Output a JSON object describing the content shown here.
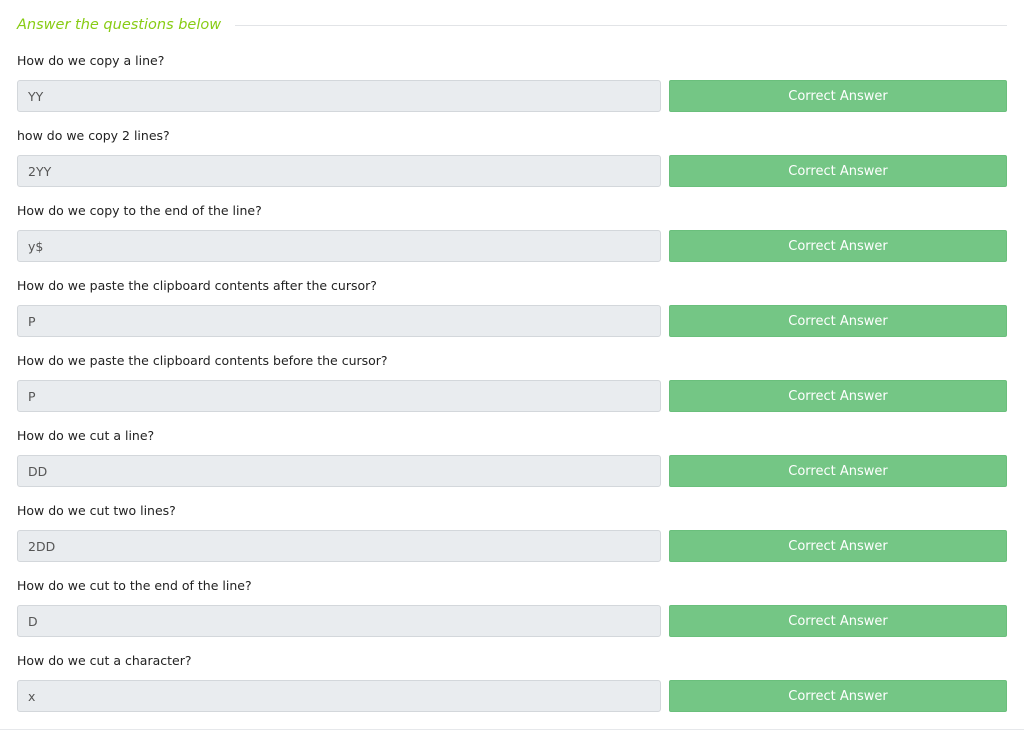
{
  "section": {
    "title": "Answer the questions below"
  },
  "button_label": "Correct Answer",
  "questions": [
    {
      "question": "How do we copy a line?",
      "answer": "YY",
      "button": "Correct Answer"
    },
    {
      "question": "how do we copy 2 lines?",
      "answer": "2YY",
      "button": "Correct Answer"
    },
    {
      "question": "How do we copy to the end of the line?",
      "answer": "y$",
      "button": "Correct Answer"
    },
    {
      "question": "How do we paste the clipboard contents after the cursor?",
      "answer": "P",
      "button": "Correct Answer"
    },
    {
      "question": "How do we paste the clipboard contents before the cursor?",
      "answer": "P",
      "button": "Correct Answer"
    },
    {
      "question": "How do we cut a line?",
      "answer": "DD",
      "button": "Correct Answer"
    },
    {
      "question": "How do we cut two lines?",
      "answer": "2DD",
      "button": "Correct Answer"
    },
    {
      "question": "How do we cut to the end of the line?",
      "answer": "D",
      "button": "Correct Answer"
    },
    {
      "question": "How do we cut a character?",
      "answer": "x",
      "button": "Correct Answer"
    }
  ],
  "colors": {
    "accent_title": "#88cc14",
    "button_bg": "#74c685",
    "input_bg": "#e9ecef"
  }
}
